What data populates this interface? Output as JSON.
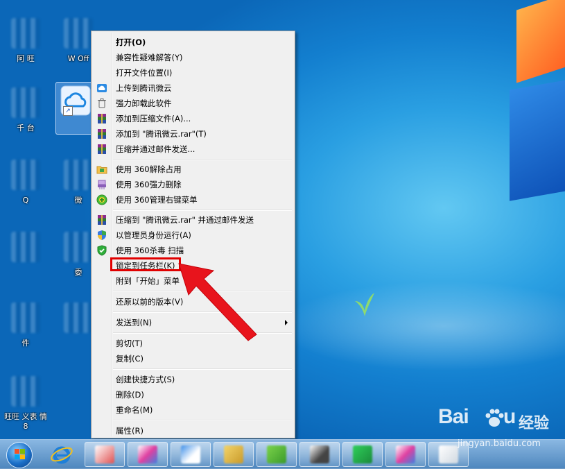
{
  "menu": {
    "items": [
      {
        "label": "打开(O)",
        "icon": "none",
        "bold": true
      },
      {
        "label": "兼容性疑难解答(Y)",
        "icon": "none"
      },
      {
        "label": "打开文件位置(I)",
        "icon": "none"
      },
      {
        "label": "上传到腾讯微云",
        "icon": "cloud-icon"
      },
      {
        "label": "强力卸载此软件",
        "icon": "trash-icon"
      },
      {
        "label": "添加到压缩文件(A)...",
        "icon": "winrar-icon"
      },
      {
        "label": "添加到 \"腾讯微云.rar\"(T)",
        "icon": "winrar-icon"
      },
      {
        "label": "压缩并通过邮件发送...",
        "icon": "winrar-icon"
      },
      {
        "label": "使用 360解除占用",
        "icon": "folder-icon"
      },
      {
        "label": "使用 360强力删除",
        "icon": "shredder-icon"
      },
      {
        "label": "使用 360管理右键菜单",
        "icon": "plus-icon"
      },
      {
        "label": "压缩到 \"腾讯微云.rar\" 并通过邮件发送",
        "icon": "winrar-icon"
      },
      {
        "label": "以管理员身份运行(A)",
        "icon": "shield-icon"
      },
      {
        "label": "使用 360杀毒 扫描",
        "icon": "antivirus-icon"
      },
      {
        "label": "锁定到任务栏(K)",
        "icon": "none"
      },
      {
        "label": "附到「开始」菜单",
        "icon": "none"
      },
      {
        "label": "还原以前的版本(V)",
        "icon": "none"
      },
      {
        "label": "发送到(N)",
        "icon": "none",
        "submenu": true
      },
      {
        "label": "剪切(T)",
        "icon": "none"
      },
      {
        "label": "复制(C)",
        "icon": "none"
      },
      {
        "label": "创建快捷方式(S)",
        "icon": "none"
      },
      {
        "label": "删除(D)",
        "icon": "none"
      },
      {
        "label": "重命名(M)",
        "icon": "none"
      },
      {
        "label": "属性(R)",
        "icon": "none"
      }
    ]
  },
  "desktop": {
    "icons": [
      {
        "label": "阿 旺"
      },
      {
        "label": "W  Off"
      },
      {
        "label": "千   台"
      },
      {
        "label": ""
      },
      {
        "label": "   Q"
      },
      {
        "label": "微"
      },
      {
        "label": ""
      },
      {
        "label": "委"
      },
      {
        "label": "   件"
      },
      {
        "label": ""
      },
      {
        "label": "旺旺 义表 情 8"
      }
    ]
  },
  "watermark": {
    "brand": "Bai",
    "brand_suffix": "u",
    "cn": "经验",
    "url": "jingyan.baidu.com"
  },
  "colors": {
    "highlight": "#e10000",
    "menu_bg": "#f0f0f0",
    "desktop_blue": "#1b8ad8"
  }
}
